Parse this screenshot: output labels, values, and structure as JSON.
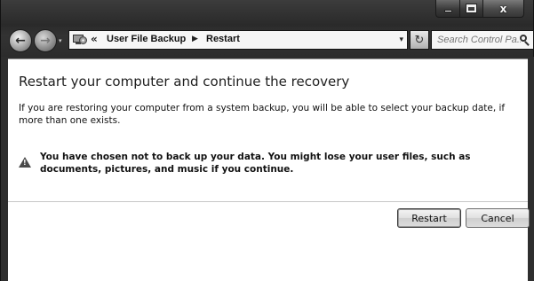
{
  "window": {
    "caption_buttons": {
      "minimize_icon": "minimize-icon",
      "maximize_icon": "maximize-icon",
      "close_glyph": "x"
    }
  },
  "navigation": {
    "back_glyph": "←",
    "forward_glyph": "→",
    "address_separator": "«",
    "breadcrumb": [
      "User File Backup",
      "Restart"
    ],
    "breadcrumb_arrow": "▶",
    "dropdown_glyph": "▾",
    "refresh_glyph": "↻",
    "search_placeholder": "Search Control Pa..."
  },
  "content": {
    "title": "Restart your computer and continue the recovery",
    "description": "If you are restoring your computer from a system backup, you will be able to select your backup date, if more than one exists.",
    "warning": "You have chosen not to back up your data. You might lose your user files, such as documents, pictures, and music if you continue.",
    "warning_mark": "!"
  },
  "buttons": {
    "restart": "Restart",
    "cancel": "Cancel"
  },
  "colors": {
    "chrome": "#2c2c2c",
    "content_bg": "#ffffff",
    "text": "#111111"
  }
}
